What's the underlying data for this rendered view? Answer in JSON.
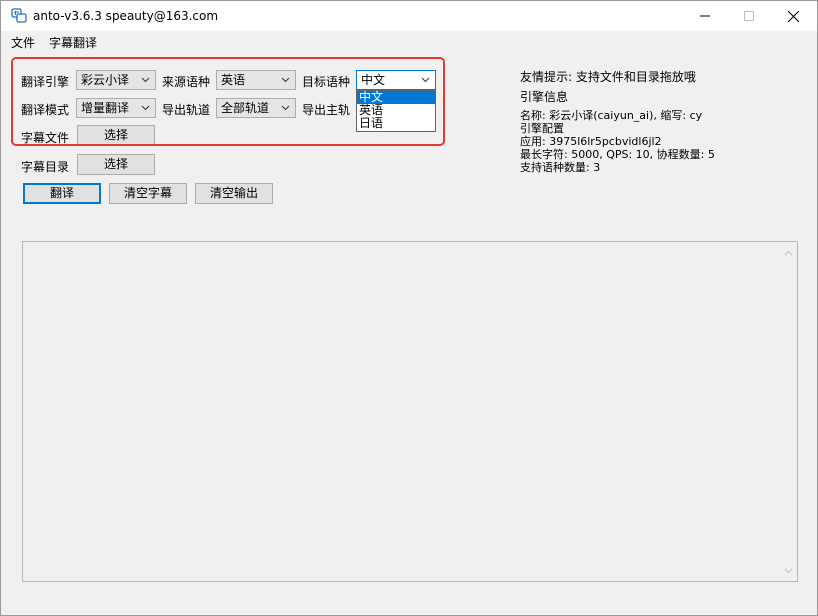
{
  "window": {
    "title": "anto-v3.6.3 speauty@163.com"
  },
  "menu": {
    "file": "文件",
    "subtitle_translate": "字幕翻译"
  },
  "form": {
    "engine_label": "翻译引擎",
    "engine_value": "彩云小译",
    "source_lang_label": "来源语种",
    "source_lang_value": "英语",
    "target_lang_label": "目标语种",
    "target_lang_value": "中文",
    "mode_label": "翻译模式",
    "mode_value": "增量翻译",
    "export_track_label": "导出轨道",
    "export_track_value": "全部轨道",
    "export_main_label": "导出主轨",
    "subtitle_file_label": "字幕文件",
    "subtitle_dir_label": "字幕目录",
    "choose": "选择"
  },
  "dropdown": {
    "options": [
      "中文",
      "英语",
      "日语"
    ]
  },
  "actions": {
    "translate": "翻译",
    "clear_subtitles": "清空字幕",
    "clear_output": "清空输出"
  },
  "info": {
    "tip": "友情提示: 支持文件和目录拖放哦",
    "engine_info_title": "引擎信息",
    "name_line": "名称: 彩云小译(caiyun_ai), 缩写: cy",
    "config_title": "引擎配置",
    "app_line": "应用: 3975l6lr5pcbvidl6jl2",
    "limits_line": "最长字符: 5000, QPS: 10, 协程数量: 5",
    "supported_line": "支持语种数量: 3"
  },
  "colors": {
    "accent": "#0078d7",
    "highlight_box": "#e53935"
  }
}
